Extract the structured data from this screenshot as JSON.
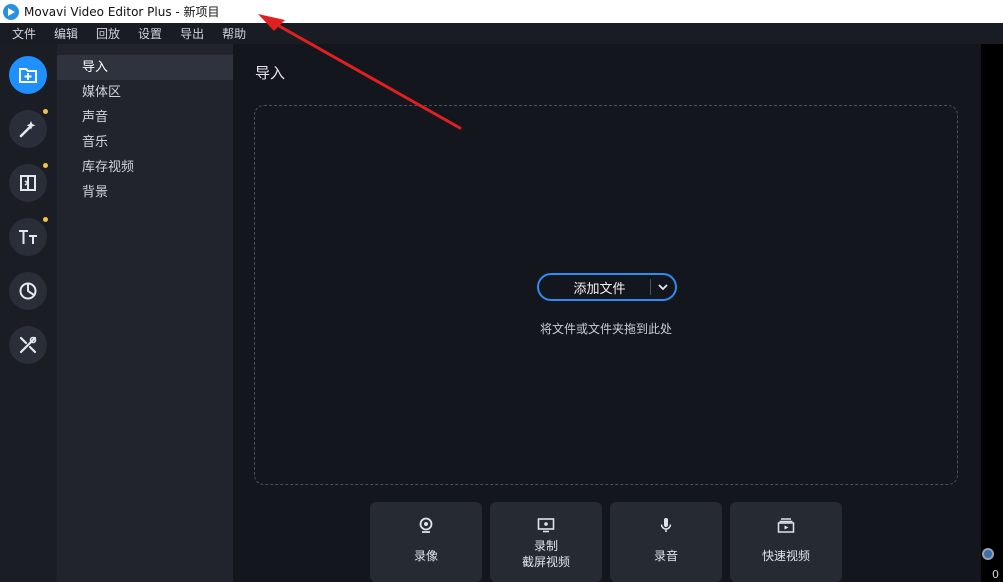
{
  "window": {
    "title": "Movavi Video Editor Plus - 新项目"
  },
  "menu": [
    "文件",
    "编辑",
    "回放",
    "设置",
    "导出",
    "帮助"
  ],
  "rail": {
    "items": [
      {
        "icon": "import-icon",
        "active": true,
        "dot": false
      },
      {
        "icon": "magic-wand-icon",
        "active": false,
        "dot": true
      },
      {
        "icon": "transition-icon",
        "active": false,
        "dot": true
      },
      {
        "icon": "titles-icon",
        "active": false,
        "dot": true
      },
      {
        "icon": "stickers-icon",
        "active": false,
        "dot": false
      },
      {
        "icon": "tools-icon",
        "active": false,
        "dot": false
      }
    ]
  },
  "categories": [
    "导入",
    "媒体区",
    "声音",
    "音乐",
    "库存视频",
    "背景"
  ],
  "main": {
    "title": "导入",
    "add_button_label": "添加文件",
    "drop_hint": "将文件或文件夹拖到此处",
    "actions": [
      {
        "icon": "webcam-icon",
        "label": "录像"
      },
      {
        "icon": "screen-record-icon",
        "label": "录制\n截屏视频"
      },
      {
        "icon": "microphone-icon",
        "label": "录音"
      },
      {
        "icon": "quick-video-icon",
        "label": "快速视频"
      }
    ]
  },
  "right_edge": {
    "digit": "0"
  },
  "colors": {
    "accent": "#1e90ff",
    "dot": "#f2c14e",
    "annotation": "#e02020"
  }
}
